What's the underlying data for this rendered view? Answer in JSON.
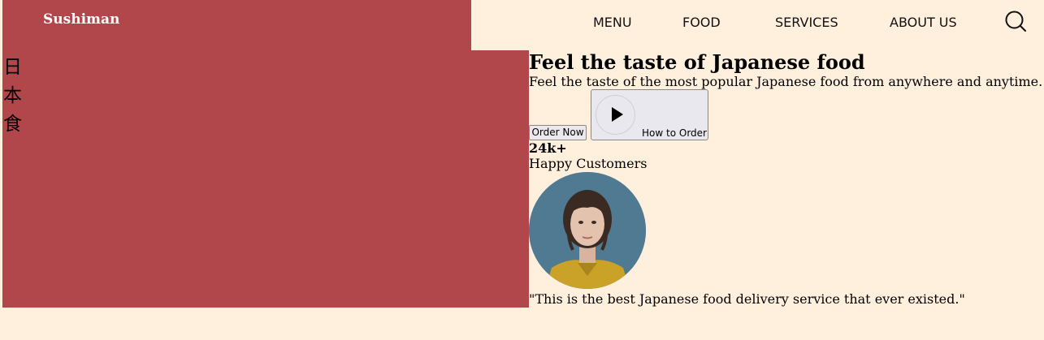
{
  "brand": {
    "name": "Sushiman"
  },
  "nav": {
    "items": [
      {
        "label": "MENU"
      },
      {
        "label": "FOOD"
      },
      {
        "label": "SERVICES"
      },
      {
        "label": "ABOUT US"
      }
    ],
    "search_icon": "search-icon"
  },
  "hero": {
    "kanji": [
      "日",
      "本",
      "食"
    ],
    "title": "Feel the taste of Japanese food",
    "subtitle": "Feel the taste of the most popular Japanese food from anywhere and anytime.",
    "order_button": "Order Now",
    "how_button": "How to Order",
    "play_icon": "play-icon"
  },
  "stats": {
    "count": "24k+",
    "label": "Happy Customers"
  },
  "testimonial": {
    "quote": "\"This is the best Japanese food delivery service that ever existed.\""
  },
  "colors": {
    "background": "#FFF0DE",
    "accent_red": "#B2474B"
  }
}
